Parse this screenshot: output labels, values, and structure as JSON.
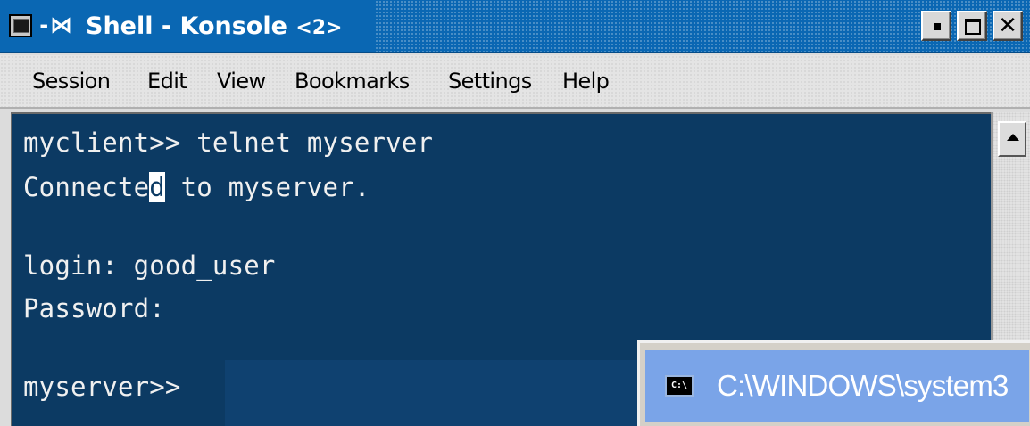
{
  "konsole": {
    "title": "Shell - Konsole",
    "title_suffix": "<2>",
    "pin_glyph": "-⋈",
    "controls": {
      "minimize_label": "",
      "maximize_label": "",
      "close_label": "✕"
    },
    "menu": [
      "Session",
      "Edit",
      "View",
      "Bookmarks",
      "Settings",
      "Help"
    ],
    "terminal": {
      "lines": [
        "myclient>> telnet myserver",
        "Connected to myserver.",
        "login: good_user",
        "Password:",
        "myserver>>"
      ],
      "cursor_line_prefix": "Connecte",
      "cursor_char": "d",
      "cursor_line_suffix": " to myserver.",
      "input_value": ""
    },
    "colors": {
      "titlebar": "#0a67b3",
      "terminal_bg": "#0c3a63",
      "terminal_fg": "#f0f0f0"
    }
  },
  "cmd_window": {
    "icon_text": "C:\\",
    "title": "C:\\WINDOWS\\system3",
    "colors": {
      "titlebar": "#7aa4e8"
    }
  },
  "icons": {
    "app": "konsole-terminal-icon",
    "pin": "pin-icon",
    "scroll_up": "scroll-up-arrow-icon",
    "cmd": "cmd-prompt-icon"
  }
}
